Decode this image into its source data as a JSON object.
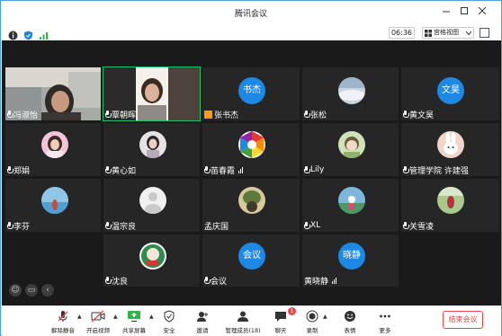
{
  "window": {
    "title": "腾讯会议"
  },
  "info": {
    "time": "06:36",
    "view_mode": "宫格视图"
  },
  "tiles": [
    {
      "name": "冯淑怡"
    },
    {
      "name": "覃朝晖"
    },
    {
      "name": "张书杰",
      "avatar_text": "书杰"
    },
    {
      "name": "张松"
    },
    {
      "name": "黄文昊",
      "avatar_text": "文昊"
    },
    {
      "name": "郑娟"
    },
    {
      "name": "黄心如"
    },
    {
      "name": "苗春霞"
    },
    {
      "name": "Lily"
    },
    {
      "name": "管理学院 许建强"
    },
    {
      "name": "李芬"
    },
    {
      "name": "温宗良"
    },
    {
      "name": "孟庆国"
    },
    {
      "name": "XL"
    },
    {
      "name": "关雪凌"
    },
    {
      "name": "沈良"
    },
    {
      "name": "会议",
      "avatar_text": "会议"
    },
    {
      "name": "黄晓静",
      "avatar_text": "晓静"
    }
  ],
  "toolbar": {
    "unmute": "解除静音",
    "video": "开启视频",
    "share": "共享屏幕",
    "security": "安全",
    "invite": "邀请",
    "members": "管理成员(18)",
    "chat": "聊天",
    "chat_badge": "1",
    "record": "录制",
    "reactions": "表情",
    "more": "更多",
    "end": "结束会议"
  },
  "colors": {
    "accent_blue": "#1e88e5",
    "end_red": "#e5484d",
    "active_green": "#1ec15f"
  }
}
